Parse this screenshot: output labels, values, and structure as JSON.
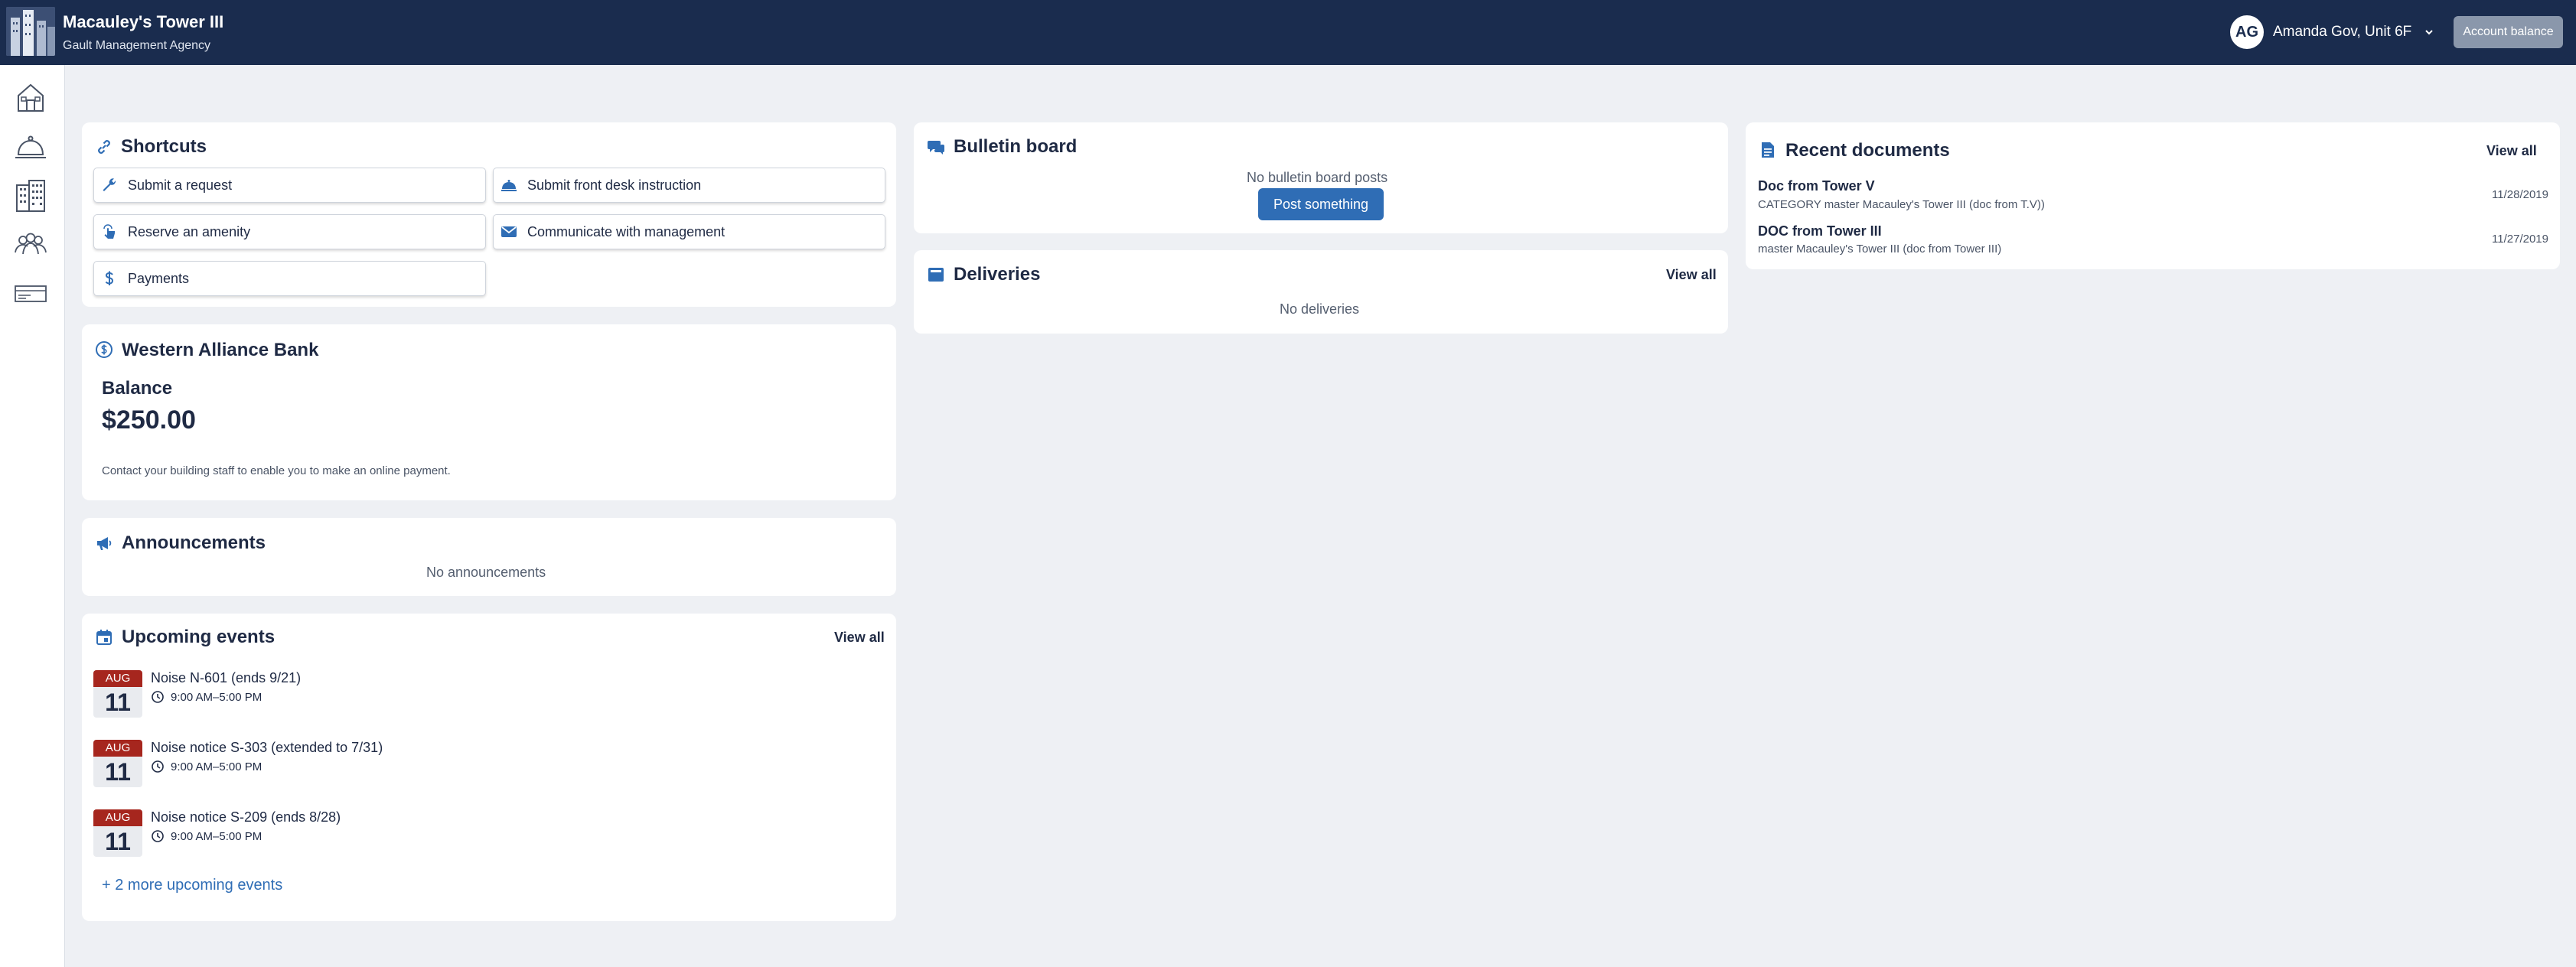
{
  "header": {
    "property_name": "Macauley's Tower III",
    "agency_name": "Gault Management Agency",
    "user_initials": "AG",
    "user_name": "Amanda Gov, Unit 6F",
    "account_balance_label": "Account balance",
    "bg_color": "#1a2c4e"
  },
  "sidebar": {
    "items": [
      {
        "icon": "home-icon"
      },
      {
        "icon": "concierge-bell-icon"
      },
      {
        "icon": "building-icon"
      },
      {
        "icon": "people-icon"
      },
      {
        "icon": "card-icon"
      }
    ]
  },
  "shortcuts": {
    "title": "Shortcuts",
    "items": [
      {
        "label": "Submit a request",
        "icon": "wrench-icon"
      },
      {
        "label": "Submit front desk instruction",
        "icon": "bell-icon"
      },
      {
        "label": "Reserve an amenity",
        "icon": "tap-icon"
      },
      {
        "label": "Communicate with management",
        "icon": "mail-icon"
      },
      {
        "label": "Payments",
        "icon": "dollar-icon"
      }
    ]
  },
  "bank": {
    "title": "Western Alliance Bank",
    "balance_label": "Balance",
    "balance_amount": "$250.00",
    "note": "Contact your building staff to enable you to make an online payment."
  },
  "announcements": {
    "title": "Announcements",
    "empty_text": "No announcements"
  },
  "events": {
    "title": "Upcoming events",
    "view_all": "View all",
    "items": [
      {
        "month": "AUG",
        "day": "11",
        "title": "Noise N-601 (ends 9/21)",
        "time": "9:00 AM–5:00 PM"
      },
      {
        "month": "AUG",
        "day": "11",
        "title": "Noise notice S-303 (extended to 7/31)",
        "time": "9:00 AM–5:00 PM"
      },
      {
        "month": "AUG",
        "day": "11",
        "title": "Noise notice S-209 (ends 8/28)",
        "time": "9:00 AM–5:00 PM"
      }
    ],
    "more_link": "+ 2 more upcoming events"
  },
  "bulletin": {
    "title": "Bulletin board",
    "empty_text": "No bulletin board posts",
    "post_button": "Post something"
  },
  "deliveries": {
    "title": "Deliveries",
    "view_all": "View all",
    "empty_text": "No deliveries"
  },
  "documents": {
    "title": "Recent documents",
    "view_all": "View all",
    "items": [
      {
        "title": "Doc from Tower V",
        "subtitle": "CATEGORY master Macauley's Tower III (doc from T.V))",
        "date": "11/28/2019"
      },
      {
        "title": "DOC from Tower III",
        "subtitle": "master Macauley's Tower III (doc from Tower III)",
        "date": "11/27/2019"
      }
    ]
  },
  "colors": {
    "accent": "#2f6db5",
    "date_badge": "#a6261e",
    "page_bg": "#eef0f4"
  }
}
